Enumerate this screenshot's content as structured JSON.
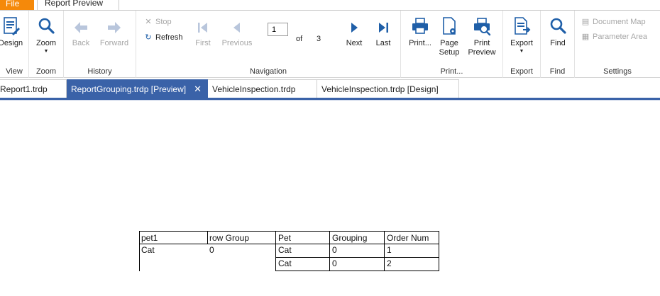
{
  "tabs": {
    "file": "File",
    "ribbon": "Report Preview"
  },
  "ribbon": {
    "groups": {
      "view": "View",
      "zoom": "Zoom",
      "history": "History",
      "navigation": "Navigation",
      "print": "Print...",
      "export": "Export",
      "find": "Find",
      "settings": "Settings"
    },
    "buttons": {
      "design": "Design",
      "zoom": "Zoom",
      "back": "Back",
      "forward": "Forward",
      "stop": "Stop",
      "refresh": "Refresh",
      "first": "First",
      "previous": "Previous",
      "of": "of",
      "total_pages": "3",
      "next": "Next",
      "last": "Last",
      "print": "Print...",
      "page_setup_1": "Page",
      "page_setup_2": "Setup",
      "print_preview_1": "Print",
      "print_preview_2": "Preview",
      "export": "Export",
      "find": "Find",
      "document_map": "Document Map",
      "parameter_area": "Parameter Area"
    },
    "page_number": "1",
    "accent_color": "#1f5fa8"
  },
  "doc_tabs": [
    {
      "label": "Report1.trdp"
    },
    {
      "label": "ReportGrouping.trdp [Preview]",
      "active": true
    },
    {
      "label": "VehicleInspection.trdp"
    },
    {
      "label": "VehicleInspection.trdp [Design]"
    }
  ],
  "report": {
    "left_headers": [
      "pet1",
      "row Group"
    ],
    "right_headers": [
      "Pet",
      "Grouping",
      "Order Num"
    ],
    "group_row": [
      "Cat",
      "0"
    ],
    "detail_rows": [
      [
        "Cat",
        "0",
        "1"
      ],
      [
        "Cat",
        "0",
        "2"
      ]
    ]
  },
  "colors": {
    "file_tab": "#f5890a",
    "active_tab": "#3a62a8"
  }
}
